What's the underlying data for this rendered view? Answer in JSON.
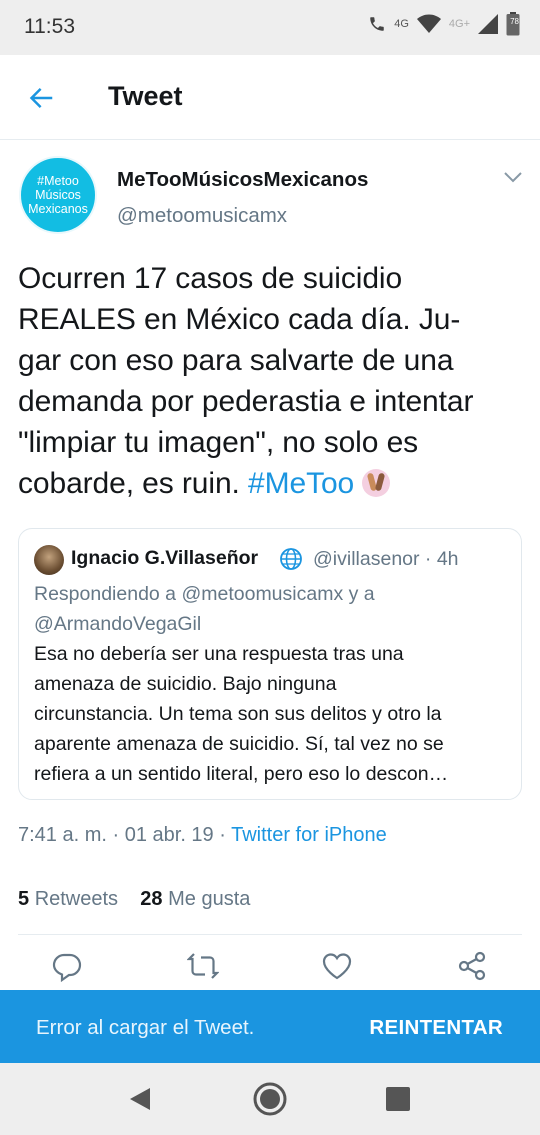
{
  "status_bar": {
    "time": "11:53",
    "network_tags": [
      "4G",
      "4G+"
    ],
    "battery": "78"
  },
  "header": {
    "title": "Tweet"
  },
  "tweet": {
    "avatar_lines": [
      "#Metoo",
      "Músicos",
      "Mexicanos"
    ],
    "author_name": "MeTooMúsicosMexicanos",
    "author_handle": "@metoomusicamx",
    "text": "Ocurren 17 casos de suicidio REALES en México cada día. Jugar con eso para salvarte de una demanda por pederastia e intentar \"limpiar tu imagen\", no solo es cobarde, es ruin.",
    "text_lines": [
      "Ocurren 17 casos de suicidio",
      "REALES en México cada día. Ju-",
      "gar con eso para salvarte de una",
      "demanda por pederastia e intentar",
      "\"limpiar tu imagen\", no solo es",
      "cobarde, es ruin."
    ],
    "hashtag": "#MeToo",
    "timestamp": "7:41 a. m. · 01 abr. 19 · ",
    "source": "Twitter for iPhone",
    "retweets_count": "5",
    "retweets_label": "Retweets",
    "likes_count": "28",
    "likes_label": "Me gusta"
  },
  "quoted_tweet": {
    "author_name": "Ignacio G.Villaseñor",
    "handle_time": "@ivillasenor · 4h",
    "reply_lines": [
      "Respondiendo a @metoomusicamx y a",
      "@ArmandoVegaGil"
    ],
    "body_lines": [
      "Esa no debería ser una respuesta tras una",
      "amenaza de suicidio. Bajo ninguna",
      "circunstancia. Un tema son sus delitos y otro la",
      "aparente amenaza de suicidio. Sí, tal vez no se",
      "refiera a un sentido literal, pero eso lo descon…"
    ]
  },
  "actions": [
    "reply-icon",
    "retweet-icon",
    "like-icon",
    "share-icon"
  ],
  "snackbar": {
    "message": "Error al cargar el Tweet.",
    "action": "REINTENTAR"
  },
  "colors": {
    "accent": "#1b95e0",
    "avatar_bg": "#12bde3",
    "secondary_text": "#657786"
  }
}
